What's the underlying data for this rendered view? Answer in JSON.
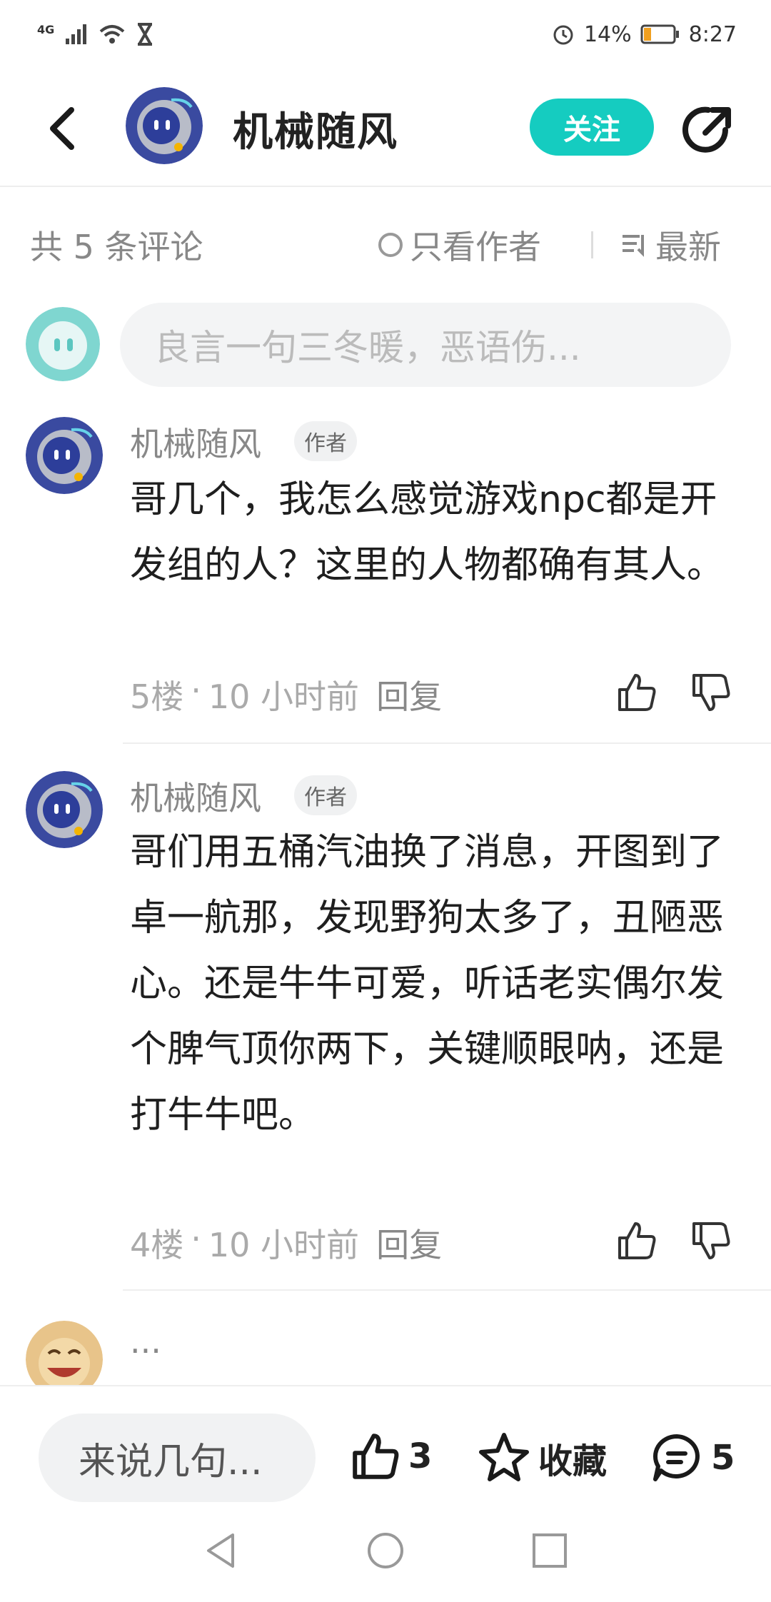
{
  "status_bar": {
    "network": "4G",
    "battery": "14%",
    "time": "8:27"
  },
  "header": {
    "title": "机械随风",
    "follow_label": "关注"
  },
  "filters": {
    "count": "共 5 条评论",
    "author_only": "只看作者",
    "sort": "最新"
  },
  "compose": {
    "placeholder": "良言一句三冬暖，恶语伤..."
  },
  "comments": [
    {
      "user": "机械随风",
      "badge": "作者",
      "text": "哥几个，我怎么感觉游戏npc都是开发组的人？这里的人物都确有其人。",
      "floor": "5楼",
      "time": "10 小时前",
      "reply": "回复"
    },
    {
      "user": "机械随风",
      "badge": "作者",
      "text": "哥们用五桶汽油换了消息，开图到了卓一航那，发现野狗太多了，丑陋恶心。还是牛牛可爱，听话老实偶尔发个脾气顶你两下，关键顺眼呐，还是打牛牛吧。",
      "floor": "4楼",
      "time": "10 小时前",
      "reply": "回复"
    },
    {
      "user": "..."
    }
  ],
  "bottom": {
    "input_placeholder": "来说几句...",
    "like_count": "3",
    "favorite_label": "收藏",
    "comment_count": "5"
  },
  "colors": {
    "accent": "#15ccc0",
    "muted": "#888888"
  }
}
